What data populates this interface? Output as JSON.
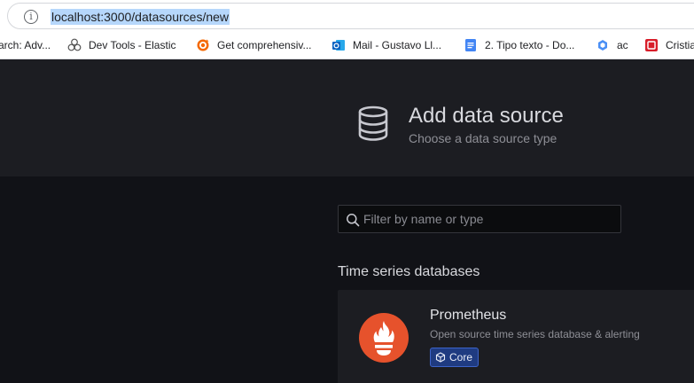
{
  "browser": {
    "url": "localhost:3000/datasources/new",
    "bookmarks": [
      {
        "label": "arch: Adv...",
        "icon": "none"
      },
      {
        "label": "Dev Tools - Elastic",
        "icon": "elastic-icon"
      },
      {
        "label": "Get comprehensiv...",
        "icon": "grafana-icon"
      },
      {
        "label": "Mail - Gustavo  Ll...",
        "icon": "outlook-icon"
      },
      {
        "label": "2. Tipo texto - Do...",
        "icon": "docs-icon"
      },
      {
        "label": "ac",
        "icon": "extension-icon"
      },
      {
        "label": "Cristia",
        "icon": "red-app-icon"
      }
    ]
  },
  "header": {
    "title": "Add data source",
    "subtitle": "Choose a data source type",
    "icon": "database-icon"
  },
  "filter": {
    "placeholder": "Filter by name or type"
  },
  "sections": [
    {
      "heading": "Time series databases",
      "items": [
        {
          "name": "Prometheus",
          "description": "Open source time series database & alerting",
          "badge": "Core",
          "logo": "prometheus-logo"
        }
      ]
    }
  ],
  "colors": {
    "background": "#111217",
    "header_band": "#1c1d22",
    "prometheus": "#e6522c",
    "badge": "#1f3b81"
  }
}
